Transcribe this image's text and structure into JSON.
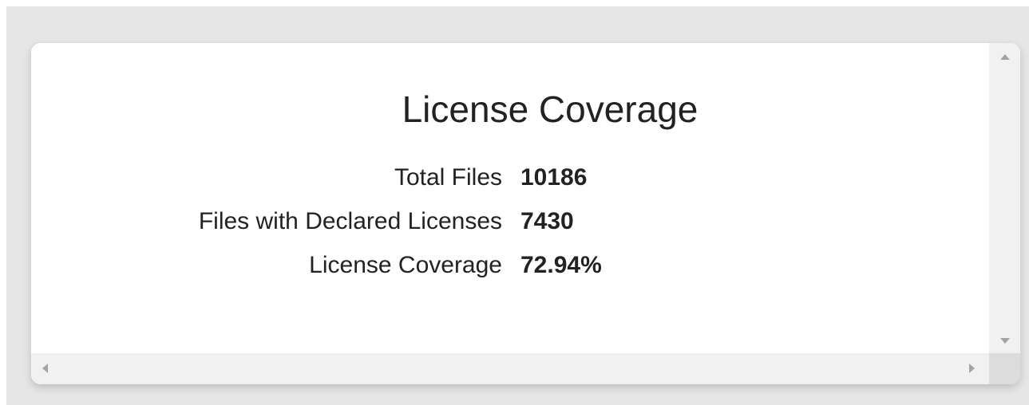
{
  "title": "License Coverage",
  "stats": [
    {
      "label": "Total Files",
      "value": "10186"
    },
    {
      "label": "Files with Declared Licenses",
      "value": "7430"
    },
    {
      "label": "License Coverage",
      "value": "72.94%"
    }
  ],
  "colors": {
    "page_background": "#e6e6e6",
    "card_background": "#ffffff",
    "text": "#222222",
    "scrollbar_track": "#f1f1f1",
    "scrollbar_arrow": "#a3a3a3"
  },
  "icons": {
    "scroll_up": "triangle-up-icon",
    "scroll_down": "triangle-down-icon",
    "scroll_left": "triangle-left-icon",
    "scroll_right": "triangle-right-icon"
  }
}
